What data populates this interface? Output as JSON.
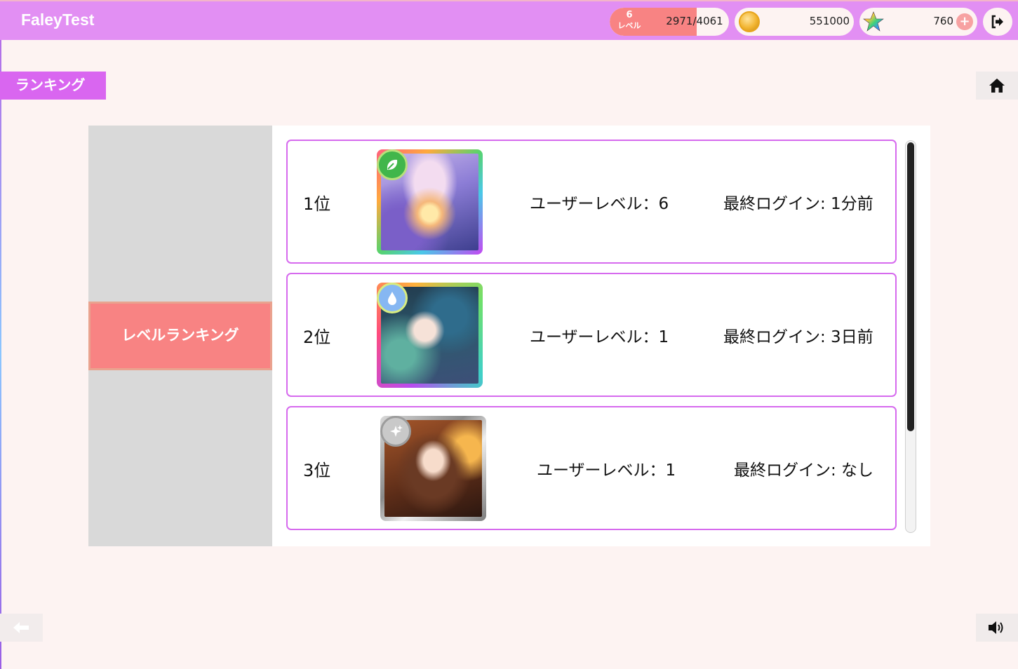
{
  "header": {
    "app_title": "FaleyTest",
    "level": {
      "value": "6",
      "label": "レベル",
      "xp_text": "2971/4061",
      "xp_progress": 0.7316
    },
    "coins": "551000",
    "stars": "760",
    "plus_label": "+"
  },
  "page": {
    "label": "ランキング"
  },
  "menu": {
    "active_tab": "レベルランキング"
  },
  "rankings": [
    {
      "rank": "1位",
      "element_icon": "leaf-icon",
      "user_level": "ユーザーレベル：6",
      "last_login": "最終ログイン: 1分前"
    },
    {
      "rank": "2位",
      "element_icon": "water-drop-icon",
      "user_level": "ユーザーレベル：1",
      "last_login": "最終ログイン: 3日前"
    },
    {
      "rank": "3位",
      "element_icon": "sparkle-icon",
      "user_level": "ユーザーレベル：1",
      "last_login": "最終ログイン: なし"
    }
  ],
  "colors": {
    "header_bg": "#e28ff3",
    "accent_pink": "#d966f0",
    "tab_coral": "#f88383",
    "card_border": "#d66aee",
    "page_bg": "#fdf3f2"
  }
}
